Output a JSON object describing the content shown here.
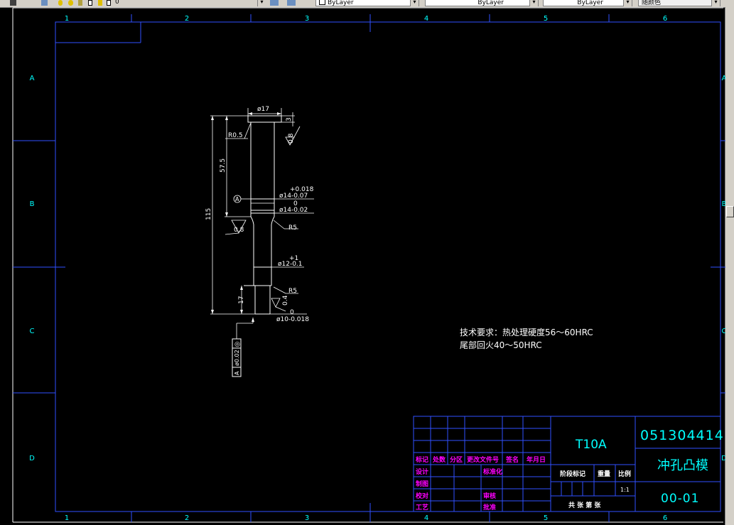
{
  "toolbar": {
    "layer_value": "0",
    "color_value": "ByLayer",
    "linetype_value": "ByLayer",
    "lineweight_value": "ByLayer",
    "plotstyle_value": "随颜色"
  },
  "frame": {
    "col_labels": [
      "1",
      "2",
      "3",
      "4",
      "5",
      "6"
    ],
    "row_labels": [
      "A",
      "B",
      "C",
      "D"
    ]
  },
  "part": {
    "dim_head_dia": "ø17",
    "dim_head_h": "3",
    "dim_r05": "R0.5",
    "dim_len_575": "57.5",
    "dim_len_115": "115",
    "dim_len_17": "17",
    "dim_tol_top_plus": "+0.018",
    "dim_d14a": "ø14-0.07",
    "dim_tol_zero1": "0",
    "dim_d14b": "ø14-0.02",
    "dim_r5a": "R5",
    "dim_tol_plus1": "+1",
    "dim_d12": "ø12-0.1",
    "dim_r5b": "R5",
    "dim_tol_zero2": "0",
    "dim_d10": "ø10-0.018",
    "rough_08a": "0.8",
    "rough_08b": "0.8",
    "rough_04": "0.4",
    "datum_a": "A",
    "fcf_symbol": "◎",
    "fcf_value": "ø0.02",
    "fcf_datum": "A"
  },
  "notes": {
    "line1": "技术要求：热处理硬度56～60HRC",
    "line2": "尾部回火40～50HRC"
  },
  "title_block": {
    "material": "T10A",
    "drawing_no": "051304414",
    "part_name": "冲孔凸模",
    "sheet_code": "00-01",
    "h_mark": "标记",
    "h_count": "处数",
    "h_zone": "分区",
    "h_docno": "更改文件号",
    "h_sign": "签名",
    "h_date": "年月日",
    "r_design": "设计",
    "r_standard": "标准化",
    "r_draw": "制图",
    "r_check": "校对",
    "r_review": "审核",
    "r_process": "工艺",
    "r_approve": "批准",
    "stage": "阶段标记",
    "weight": "重量",
    "scale_label": "比例",
    "scale_value": "1:1",
    "sheets": "共 张 第 张"
  }
}
